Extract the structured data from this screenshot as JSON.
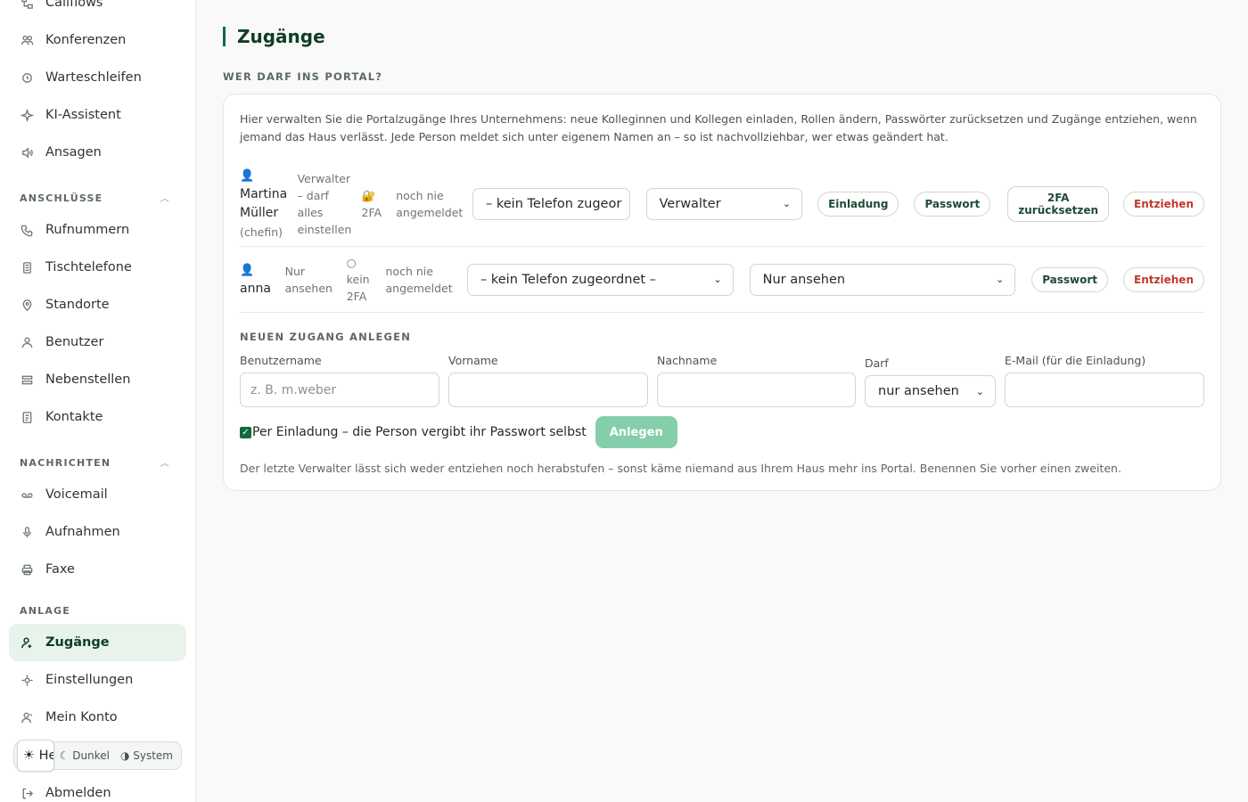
{
  "sidebar": {
    "items_top": [
      {
        "name": "callflows",
        "label": "Callflows",
        "icon": "flow-icon"
      },
      {
        "name": "konferenzen",
        "label": "Konferenzen",
        "icon": "users-icon"
      },
      {
        "name": "warteschleifen",
        "label": "Warteschleifen",
        "icon": "clock-icon"
      },
      {
        "name": "ki-assistent",
        "label": "KI-Assistent",
        "icon": "sparkle-icon"
      },
      {
        "name": "ansagen",
        "label": "Ansagen",
        "icon": "speaker-icon"
      }
    ],
    "sections": {
      "anschluesse": "ANSCHLÜSSE",
      "nachrichten": "NACHRICHTEN",
      "anlage": "ANLAGE"
    },
    "items_anschluesse": [
      {
        "label": "Rufnummern"
      },
      {
        "label": "Tischtelefone"
      },
      {
        "label": "Standorte"
      },
      {
        "label": "Benutzer"
      },
      {
        "label": "Nebenstellen"
      },
      {
        "label": "Kontakte"
      }
    ],
    "items_nachrichten": [
      {
        "label": "Voicemail"
      },
      {
        "label": "Aufnahmen"
      },
      {
        "label": "Faxe"
      }
    ],
    "items_anlage": [
      {
        "label": "Zugänge"
      },
      {
        "label": "Einstellungen"
      },
      {
        "label": "Mein Konto"
      }
    ],
    "theme": {
      "hell": "☀ Hell",
      "dunkel": "☾ Dunkel",
      "system": "◑ System",
      "selected": "Hell"
    },
    "logout": "Abmelden"
  },
  "page": {
    "title": "Zugänge",
    "section_label": "WER DARF INS PORTAL?",
    "intro": "Hier verwalten Sie die Portalzugänge Ihres Unternehmens: neue Kolleginnen und Kollegen einladen, Rollen ändern, Passwörter zurücksetzen und Zugänge entziehen, wenn jemand das Haus verlässt. Jede Person meldet sich unter eigenem Namen an – so ist nachvollziehbar, wer etwas geändert hat."
  },
  "users": [
    {
      "icon": "👤",
      "name_line1": "Martina",
      "name_line2": "Müller",
      "username": "(chefin)",
      "role_text_1": "Verwalter",
      "role_text_2": "– darf",
      "role_text_3": "alles",
      "role_text_4": "einstellen",
      "twofa_icon": "🔐",
      "twofa_text": "2FA",
      "login_1": "noch nie",
      "login_2": "angemeldet",
      "phone": "– kein Telefon zugeor",
      "role": "Verwalter",
      "btn_invite": "Einladung",
      "btn_password": "Passwort",
      "btn_2fa_1": "2FA",
      "btn_2fa_2": "zurücksetzen",
      "btn_revoke": "Entziehen"
    },
    {
      "icon": "👤",
      "name": "anna",
      "role_text_1": "Nur",
      "role_text_2": "ansehen",
      "twofa_icon": "○",
      "twofa_text_1": "kein",
      "twofa_text_2": "2FA",
      "login_1": "noch nie",
      "login_2": "angemeldet",
      "phone": "– kein Telefon zugeordnet –",
      "role": "Nur ansehen",
      "btn_password": "Passwort",
      "btn_revoke": "Entziehen"
    }
  ],
  "new_access": {
    "heading": "NEUEN ZUGANG ANLEGEN",
    "username_label": "Benutzername",
    "username_placeholder": "z. B. m.weber",
    "firstname_label": "Vorname",
    "lastname_label": "Nachname",
    "role_label": "Darf",
    "role_value": "nur ansehen",
    "email_label": "E-Mail (für die Einladung)",
    "invite_checkbox": "Per Einladung – die Person vergibt ihr Passwort selbst",
    "invite_checked": true,
    "create_button": "Anlegen",
    "note": "Der letzte Verwalter lässt sich weder entziehen noch herabstufen – sonst käme niemand aus Ihrem Haus mehr ins Portal. Benennen Sie vorher einen zweiten."
  },
  "colors": {
    "accent": "#0f6b3c",
    "active_bg": "#e8f3ec",
    "danger": "#c0392b",
    "create_btn": "#84cfaa"
  }
}
